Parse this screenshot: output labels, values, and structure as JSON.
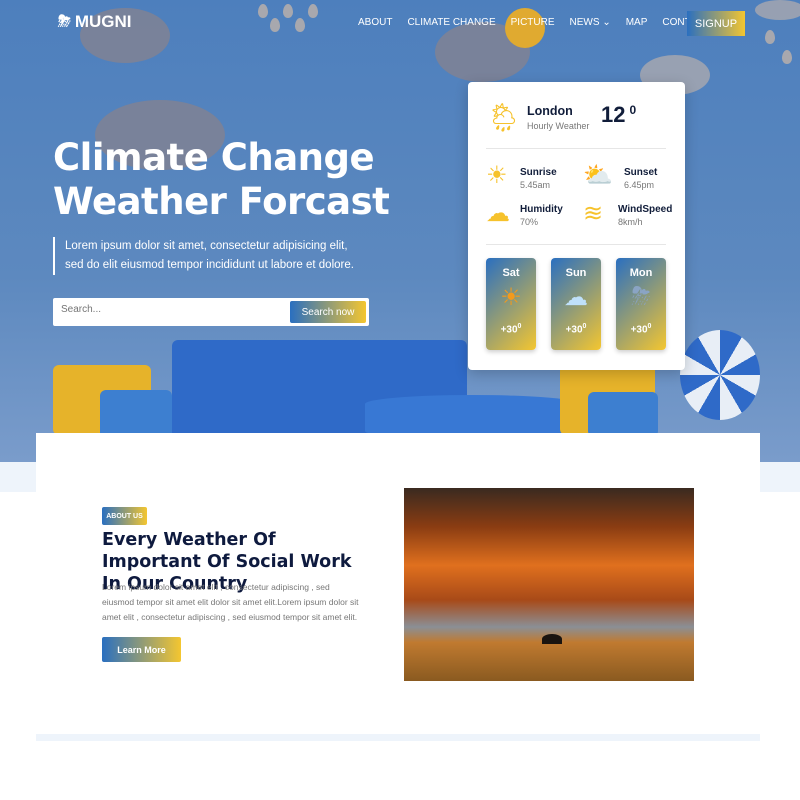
{
  "header": {
    "logo_text": "MUGNI",
    "nav": [
      "ABOUT",
      "CLIMATE CHANGE",
      "PICTURE",
      "NEWS",
      "MAP",
      "CONTACT"
    ],
    "signup": "SIGNUP"
  },
  "hero": {
    "title_line1": "Climate Change",
    "title_line2": "Weather Forcast",
    "description": "Lorem ipsum dolor sit amet, consectetur adipisicing elit, sed do elit eiusmod tempor incididunt ut labore et dolore.",
    "search_placeholder": "Search...",
    "search_button": "Search now"
  },
  "weather": {
    "city": "London",
    "subtitle": "Hourly Weather",
    "temp": "12",
    "deg": "0",
    "stats": [
      {
        "label": "Sunrise",
        "value": "5.45am",
        "icon": "sun-icon"
      },
      {
        "label": "Sunset",
        "value": "6.45pm",
        "icon": "sun-cloud-icon"
      },
      {
        "label": "Humidity",
        "value": "70%",
        "icon": "rain-cloud-icon"
      },
      {
        "label": "WindSpeed",
        "value": "8km/h",
        "icon": "wind-icon"
      }
    ],
    "forecast": [
      {
        "day": "Sat",
        "temp": "+30",
        "deg": "0",
        "icon": "sun-icon"
      },
      {
        "day": "Sun",
        "temp": "+30",
        "deg": "0",
        "icon": "cloud-icon"
      },
      {
        "day": "Mon",
        "temp": "+30",
        "deg": "0",
        "icon": "storm-icon"
      }
    ]
  },
  "about": {
    "badge": "ABOUT US",
    "heading": "Every Weather Of Important Of Social Work In Our Country",
    "text": "Lorem ipsum dolor sit amet elit , consectetur adipiscing , sed eiusmod tempor sit amet elit dolor sit amet elit.Lorem ipsum dolor sit amet elit , consectetur adipiscing , sed eiusmod tempor sit amet elit.",
    "button": "Learn More"
  },
  "colors": {
    "primary": "#2a6fc0",
    "accent": "#f4c630",
    "dark": "#0e1a3e"
  }
}
